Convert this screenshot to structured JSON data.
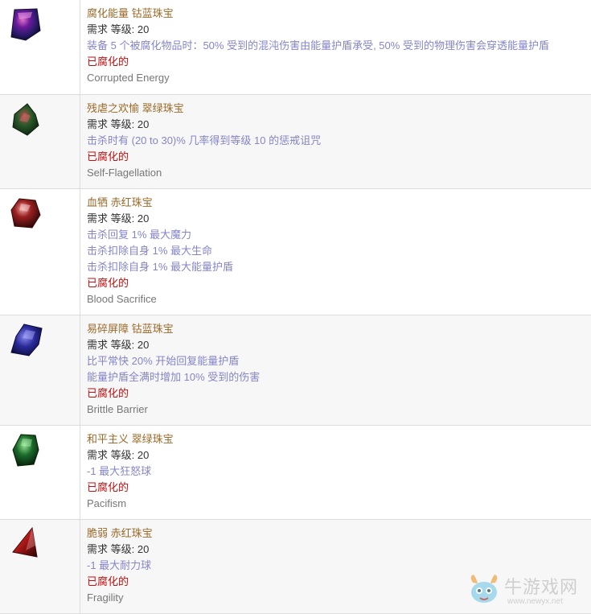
{
  "items": [
    {
      "title": "腐化能量 钴蓝珠宝",
      "req": "需求 等级: 20",
      "mods": [
        "装备 5 个被腐化物品时：50% 受到的混沌伤害由能量护盾承受, 50% 受到的物理伤害会穿透能量护盾"
      ],
      "corrupted": "已腐化的",
      "en": "Corrupted Energy",
      "icon": "cobalt-jewel-icon"
    },
    {
      "title": "残虐之欢愉 翠绿珠宝",
      "req": "需求 等级: 20",
      "mods": [
        "击杀时有 (20 to 30)% 几率得到等级 10 的惩戒诅咒"
      ],
      "corrupted": "已腐化的",
      "en": "Self-Flagellation",
      "icon": "viridian-jewel-icon"
    },
    {
      "title": "血牺 赤红珠宝",
      "req": "需求 等级: 20",
      "mods": [
        "击杀回复 1% 最大魔力",
        "击杀扣除自身 1% 最大生命",
        "击杀扣除自身 1% 最大能量护盾"
      ],
      "corrupted": "已腐化的",
      "en": "Blood Sacrifice",
      "icon": "crimson-jewel-icon"
    },
    {
      "title": "易碎屏障 钴蓝珠宝",
      "req": "需求 等级: 20",
      "mods": [
        "比平常快 20% 开始回复能量护盾",
        "能量护盾全满时增加 10% 受到的伤害"
      ],
      "corrupted": "已腐化的",
      "en": "Brittle Barrier",
      "icon": "cobalt-jewel-icon"
    },
    {
      "title": "和平主义 翠绿珠宝",
      "req": "需求 等级: 20",
      "mods": [
        "-1 最大狂怒球"
      ],
      "corrupted": "已腐化的",
      "en": "Pacifism",
      "icon": "viridian-jewel-icon"
    },
    {
      "title": "脆弱 赤红珠宝",
      "req": "需求 等级: 20",
      "mods": [
        "-1 最大耐力球"
      ],
      "corrupted": "已腐化的",
      "en": "Fragility",
      "icon": "crimson-jewel-icon"
    }
  ],
  "watermark": {
    "name": "牛游戏网",
    "url": "www.newyx.net"
  },
  "colors": {
    "title": "#9a6a2a",
    "mod": "#8585c8",
    "corrupted": "#bb1111",
    "english": "#777777",
    "border": "#dddddd",
    "alt_row": "#f7f7f7"
  }
}
